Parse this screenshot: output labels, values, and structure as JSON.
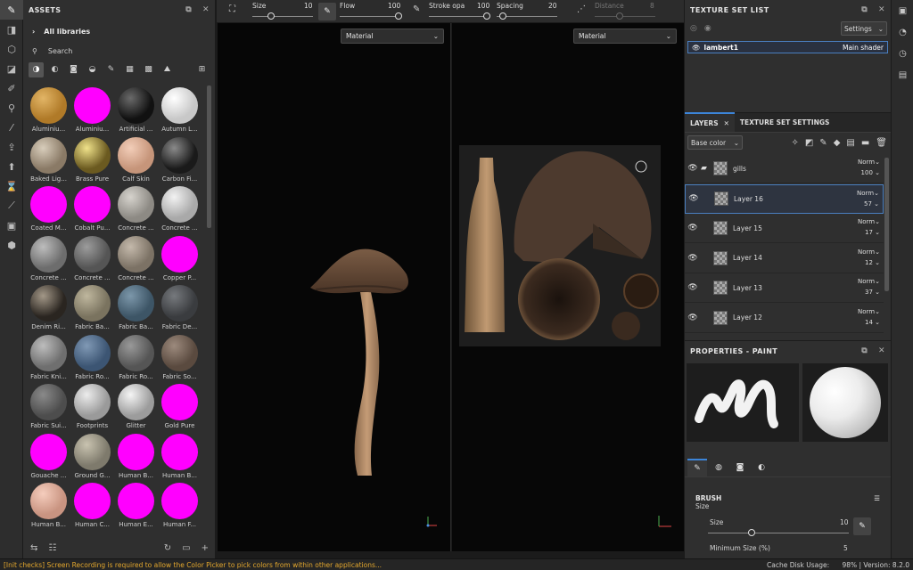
{
  "tools": [
    {
      "icon": "paint-brush-icon",
      "glyph": "✎"
    },
    {
      "icon": "eraser-icon",
      "glyph": "◨"
    },
    {
      "icon": "projection-icon",
      "glyph": "⬡"
    },
    {
      "icon": "polygon-fill-icon",
      "glyph": "◪"
    },
    {
      "icon": "smudge-icon",
      "glyph": "✐"
    },
    {
      "icon": "clone-stamp-icon",
      "glyph": "⚲"
    },
    {
      "icon": "color-picker-icon",
      "glyph": "⁄"
    },
    {
      "icon": "export-icon",
      "glyph": "⇪"
    },
    {
      "icon": "bake-icon",
      "glyph": "⬆"
    },
    {
      "icon": "hourglass-icon",
      "glyph": "⌛"
    },
    {
      "icon": "measure-icon",
      "glyph": "⟋"
    },
    {
      "icon": "photo-icon",
      "glyph": "▣"
    },
    {
      "icon": "mesh-icon",
      "glyph": "⬢"
    }
  ],
  "assets": {
    "title": "ASSETS",
    "library": "All libraries",
    "search": "Search",
    "filters": [
      "material-filter-icon",
      "smart-material-filter-icon",
      "mask-filter-icon",
      "filter-filter-icon",
      "brush-filter-icon",
      "alpha-filter-icon",
      "texture-filter-icon",
      "environment-filter-icon",
      "grid-view-icon"
    ],
    "items": [
      {
        "label": "Aluminiu...",
        "color": "#b07a28",
        "hl": "#e2b566"
      },
      {
        "label": "Aluminiu...",
        "color": "#ff00ff",
        "hl": "#ff00ff"
      },
      {
        "label": "Artificial ...",
        "color": "#111111",
        "hl": "#6a6a6a"
      },
      {
        "label": "Autumn L...",
        "color": "#c8c8c8",
        "hl": "#ffffff"
      },
      {
        "label": "Baked Lig...",
        "color": "#8a7a66",
        "hl": "#d8cdbb"
      },
      {
        "label": "Brass Pure",
        "color": "#6b5a20",
        "hl": "#f0e28a"
      },
      {
        "label": "Calf Skin",
        "color": "#c6957a",
        "hl": "#f2cdb8"
      },
      {
        "label": "Carbon Fi...",
        "color": "#1a1a1a",
        "hl": "#8a8a8a"
      },
      {
        "label": "Coated M...",
        "color": "#ff00ff",
        "hl": "#ff00ff"
      },
      {
        "label": "Cobalt Pu...",
        "color": "#ff00ff",
        "hl": "#ff00ff"
      },
      {
        "label": "Concrete ...",
        "color": "#8d8a84",
        "hl": "#d6d3cd"
      },
      {
        "label": "Concrete ...",
        "color": "#a9a9a9",
        "hl": "#f2f2f2"
      },
      {
        "label": "Concrete ...",
        "color": "#6d6d6d",
        "hl": "#bdbdbd"
      },
      {
        "label": "Concrete ...",
        "color": "#555555",
        "hl": "#9c9c9c"
      },
      {
        "label": "Concrete ...",
        "color": "#7c7265",
        "hl": "#c4b9ab"
      },
      {
        "label": "Copper P...",
        "color": "#ff00ff",
        "hl": "#ff00ff"
      },
      {
        "label": "Denim Ri...",
        "color": "#2a2520",
        "hl": "#a39888"
      },
      {
        "label": "Fabric Ba...",
        "color": "#7a735f",
        "hl": "#bfb79e"
      },
      {
        "label": "Fabric Ba...",
        "color": "#3d5566",
        "hl": "#7c97aa"
      },
      {
        "label": "Fabric De...",
        "color": "#3a3c3f",
        "hl": "#76797d"
      },
      {
        "label": "Fabric Kni...",
        "color": "#6f6f6f",
        "hl": "#bdbdbd"
      },
      {
        "label": "Fabric Ro...",
        "color": "#3c5573",
        "hl": "#8099b5"
      },
      {
        "label": "Fabric Ro...",
        "color": "#555555",
        "hl": "#999999"
      },
      {
        "label": "Fabric So...",
        "color": "#5a4a3f",
        "hl": "#9c8a7d"
      },
      {
        "label": "Fabric Sui...",
        "color": "#4d4d4d",
        "hl": "#8a8a8a"
      },
      {
        "label": "Footprints",
        "color": "#9a9a9a",
        "hl": "#ececec"
      },
      {
        "label": "Glitter",
        "color": "#9c9c9c",
        "hl": "#f5f5f5"
      },
      {
        "label": "Gold Pure",
        "color": "#ff00ff",
        "hl": "#ff00ff"
      },
      {
        "label": "Gouache ...",
        "color": "#ff00ff",
        "hl": "#ff00ff"
      },
      {
        "label": "Ground G...",
        "color": "#7e7a6c",
        "hl": "#c9c3b0"
      },
      {
        "label": "Human B...",
        "color": "#ff00ff",
        "hl": "#ff00ff"
      },
      {
        "label": "Human B...",
        "color": "#ff00ff",
        "hl": "#ff00ff"
      },
      {
        "label": "Human B...",
        "color": "#c99481",
        "hl": "#f5cdbd"
      },
      {
        "label": "Human C...",
        "color": "#ff00ff",
        "hl": "#ff00ff"
      },
      {
        "label": "Human E...",
        "color": "#ff00ff",
        "hl": "#ff00ff"
      },
      {
        "label": "Human F...",
        "color": "#ff00ff",
        "hl": "#ff00ff"
      }
    ]
  },
  "toolbar": {
    "size_label": "Size",
    "size_value": "10",
    "flow_label": "Flow",
    "flow_value": "100",
    "stroke_label": "Stroke opa",
    "stroke_value": "100",
    "spacing_label": "Spacing",
    "spacing_value": "20",
    "distance_label": "Distance",
    "distance_value": "8"
  },
  "viewport3d": {
    "select": "Material"
  },
  "viewport2d": {
    "select": "Material"
  },
  "texture_set_list": {
    "title": "TEXTURE SET LIST",
    "settings": "Settings",
    "item_name": "lambert1",
    "item_shader": "Main shader"
  },
  "layers": {
    "tab_layers": "LAYERS",
    "tab_tss": "TEXTURE SET SETTINGS",
    "channel": "Base color",
    "rows": [
      {
        "name": "gills",
        "blend": "Norm",
        "opacity": "100",
        "folder": true,
        "selected": false
      },
      {
        "name": "Layer 16",
        "blend": "Norm",
        "opacity": "57",
        "folder": false,
        "selected": true
      },
      {
        "name": "Layer 15",
        "blend": "Norm",
        "opacity": "17",
        "folder": false,
        "selected": false
      },
      {
        "name": "Layer 14",
        "blend": "Norm",
        "opacity": "12",
        "folder": false,
        "selected": false
      },
      {
        "name": "Layer 13",
        "blend": "Norm",
        "opacity": "37",
        "folder": false,
        "selected": false
      },
      {
        "name": "Layer 12",
        "blend": "Norm",
        "opacity": "14",
        "folder": false,
        "selected": false
      }
    ]
  },
  "properties": {
    "title": "PROPERTIES - PAINT",
    "section": "BRUSH",
    "size_group": "Size",
    "size_label": "Size",
    "size_value": "10",
    "min_size_label": "Minimum Size (%)",
    "min_size_value": "5"
  },
  "status": {
    "message": "[Init checks] Screen Recording is required to allow the Color Picker to pick colors from within other applications...",
    "cache_label": "Cache Disk Usage:",
    "cache_value": "98%",
    "version": "| Version: 8.2.0"
  }
}
